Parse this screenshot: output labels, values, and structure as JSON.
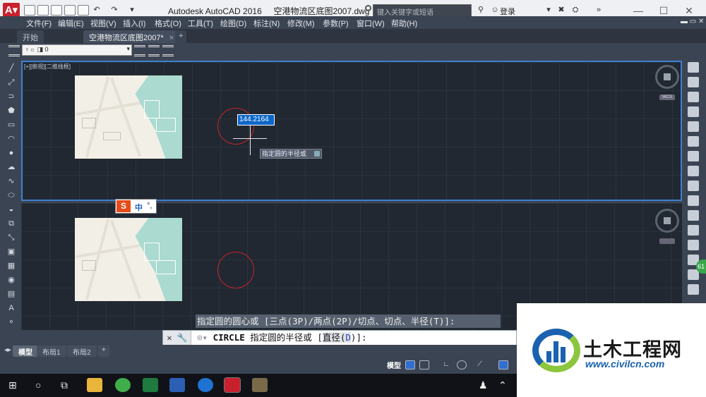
{
  "window": {
    "app_title": "Autodesk AutoCAD 2016",
    "file_name": "空港物流区底图2007.dwg",
    "search_placeholder": "键入关键字或短语",
    "login_label": "登录"
  },
  "menu": [
    "文件(F)",
    "编辑(E)",
    "视图(V)",
    "插入(I)",
    "格式(O)",
    "工具(T)",
    "绘图(D)",
    "标注(N)",
    "修改(M)",
    "参数(P)",
    "窗口(W)",
    "帮助(H)"
  ],
  "doc_tabs": {
    "start_label": "开始",
    "active_label": "空港物流区底图2007*",
    "close_glyph": "×",
    "add_glyph": "+"
  },
  "layer_toolbar": {
    "current_layer": "0"
  },
  "viewport": {
    "label": "[+][俯视][二维线框]",
    "dynamic_input_value": "144.2164",
    "tooltip_text": "指定圆的半径或",
    "wcs_label": "WCS"
  },
  "ime": {
    "logo": "S",
    "mode": "中",
    "punct": "°,"
  },
  "command": {
    "history_line": "指定圆的圆心或 [三点(3P)/两点(2P)/切点、切点、半径(T)]:",
    "command_name": "CIRCLE",
    "prompt_text": "指定圆的半径或",
    "option_open": "[",
    "option_label": "直径(",
    "option_key": "D",
    "option_close": ")]:"
  },
  "layout_tabs": [
    "模型",
    "布局1",
    "布局2"
  ],
  "status_bar": {
    "model_label": "模型"
  },
  "watermark": {
    "title": "土木工程网",
    "url": "www.civilcn.com"
  },
  "side_badge": "61",
  "colors": {
    "drawing_bg": "#212831",
    "ui_bg": "#3b4453",
    "circle_red": "#c8232c",
    "input_blue": "#0b67c9"
  }
}
